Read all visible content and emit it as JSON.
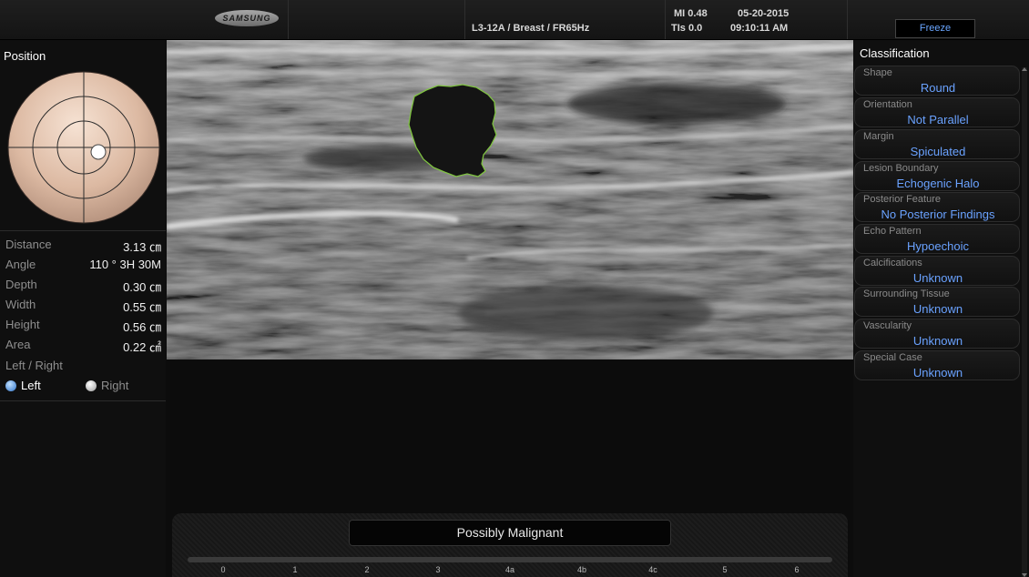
{
  "header": {
    "brand": "SAMSUNG",
    "probe_info": "L3-12A / Breast / FR65Hz",
    "mi": "MI  0.48",
    "tis": "TIs  0.0",
    "date": "05-20-2015",
    "time": "09:10:11 AM",
    "freeze_label": "Freeze"
  },
  "left_panel": {
    "position_title": "Position",
    "measurements": [
      {
        "label": "Distance",
        "value": "3.13 ㎝"
      },
      {
        "label": "Angle",
        "value": "110 ° 3H 30M"
      },
      {
        "label": "Depth",
        "value": "0.30 ㎝"
      },
      {
        "label": "Width",
        "value": "0.55 ㎝"
      },
      {
        "label": "Height",
        "value": "0.56 ㎝"
      },
      {
        "label": "Area",
        "value": "0.22 ㎠"
      }
    ],
    "side_label": "Left / Right",
    "side_options": [
      {
        "label": "Left",
        "selected": true
      },
      {
        "label": "Right",
        "selected": false
      }
    ]
  },
  "classification": {
    "title": "Classification",
    "items": [
      {
        "label": "Shape",
        "value": "Round"
      },
      {
        "label": "Orientation",
        "value": "Not Parallel"
      },
      {
        "label": "Margin",
        "value": "Spiculated"
      },
      {
        "label": "Lesion Boundary",
        "value": "Echogenic Halo"
      },
      {
        "label": "Posterior Feature",
        "value": "No Posterior Findings"
      },
      {
        "label": "Echo Pattern",
        "value": "Hypoechoic"
      },
      {
        "label": "Calcifications",
        "value": "Unknown"
      },
      {
        "label": "Surrounding Tissue",
        "value": "Unknown"
      },
      {
        "label": "Vascularity",
        "value": "Unknown"
      },
      {
        "label": "Special Case",
        "value": "Unknown"
      }
    ]
  },
  "result": {
    "text": "Possibly Malignant",
    "scale": [
      "0",
      "1",
      "2",
      "3",
      "4a",
      "4b",
      "4c",
      "5",
      "6"
    ]
  },
  "colors": {
    "accent_blue": "#6aa2ff",
    "lesion_outline": "#7fc241"
  },
  "icons": {
    "position_marker": "breast-position-wheel",
    "radio_selected": "radio-selected-blue",
    "radio_unselected": "radio-unselected-white"
  }
}
